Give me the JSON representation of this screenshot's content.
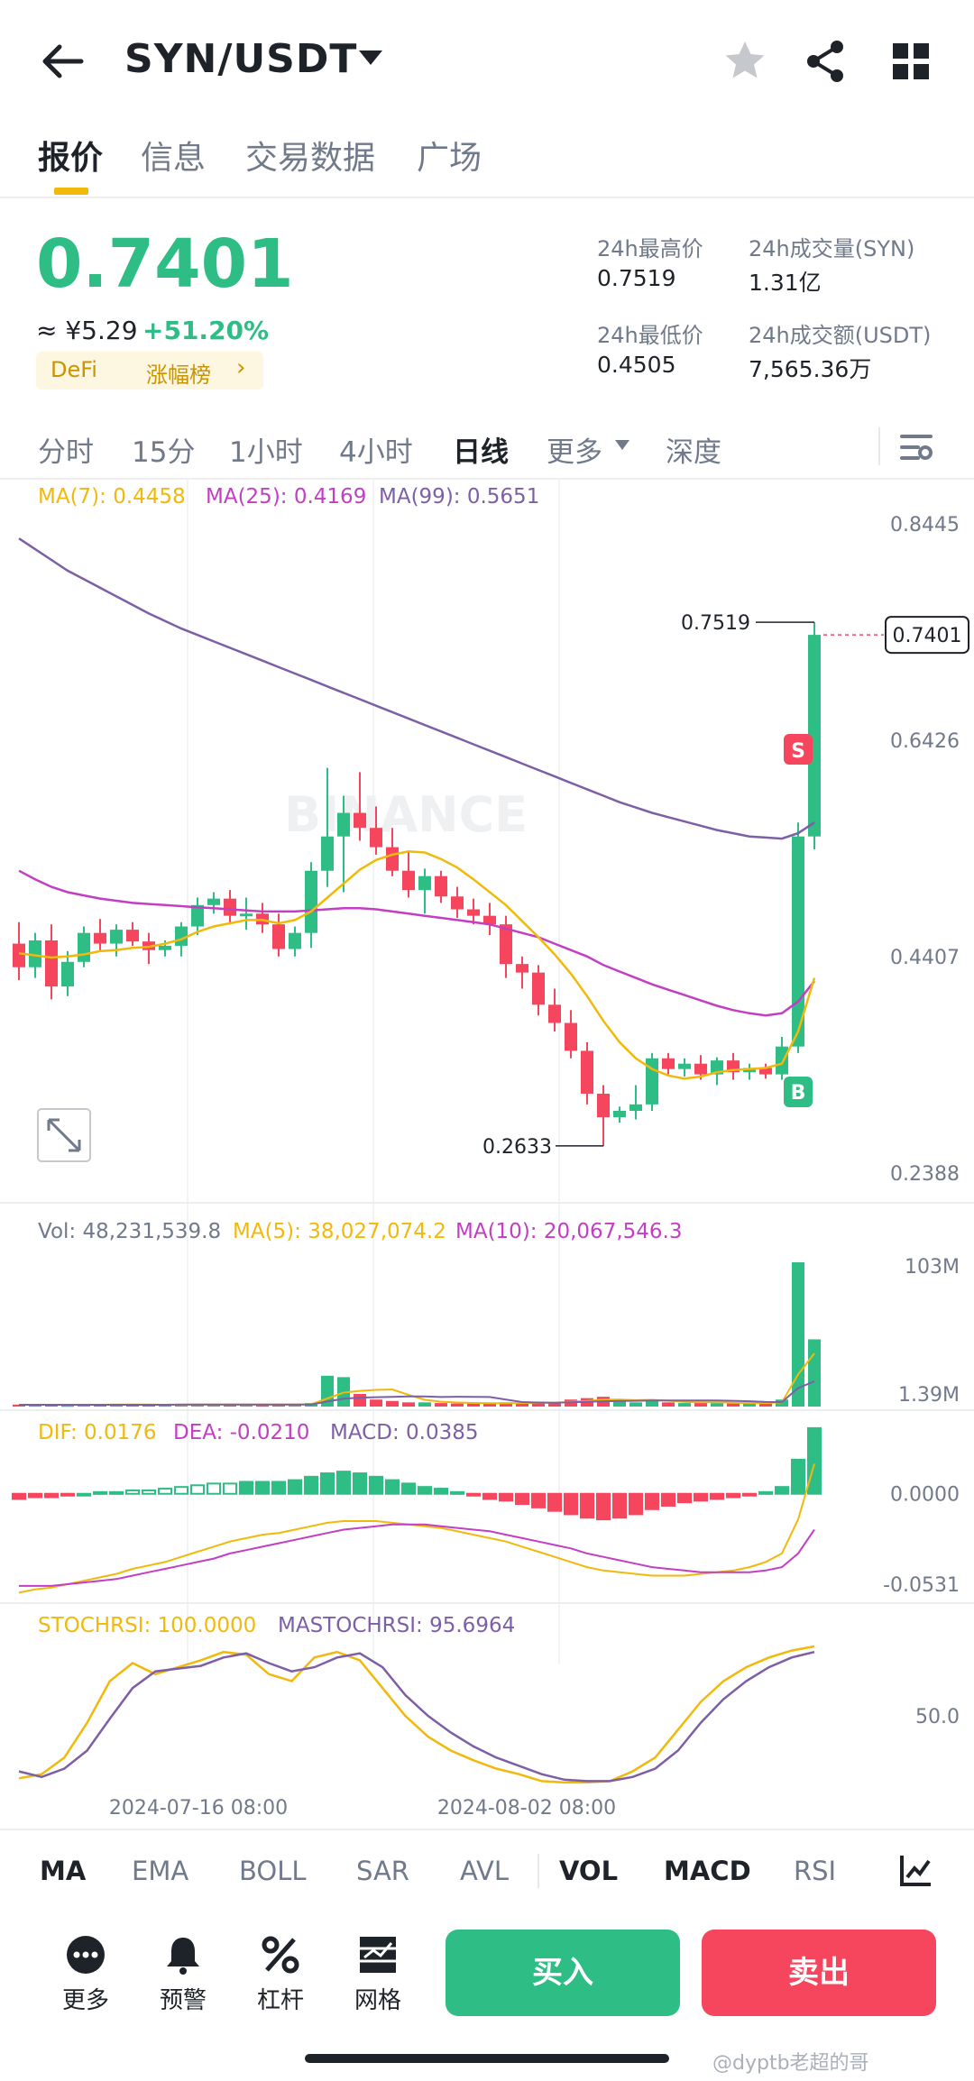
{
  "header": {
    "pair": "SYN/USDT",
    "back_icon": "arrow-left-icon",
    "favorite_icon": "star-icon",
    "share_icon": "share-icon",
    "menu_icon": "grid-icon"
  },
  "tabs": [
    {
      "label": "报价",
      "active": true
    },
    {
      "label": "信息",
      "active": false
    },
    {
      "label": "交易数据",
      "active": false
    },
    {
      "label": "广场",
      "active": false
    }
  ],
  "ticker": {
    "price": "0.7401",
    "cny": "≈ ¥5.29",
    "change": "+51.20%",
    "tag_category": "DeFi",
    "tag_rank": "涨幅榜",
    "tag_arrow": "›",
    "high_label": "24h最高价",
    "high_value": "0.7519",
    "low_label": "24h最低价",
    "low_value": "0.4505",
    "vol_label": "24h成交量(SYN)",
    "vol_value": "1.31亿",
    "amt_label": "24h成交额(USDT)",
    "amt_value": "7,565.36万"
  },
  "intervals": [
    {
      "label": "分时",
      "active": false
    },
    {
      "label": "15分",
      "active": false
    },
    {
      "label": "1小时",
      "active": false
    },
    {
      "label": "4小时",
      "active": false
    },
    {
      "label": "日线",
      "active": true
    },
    {
      "label": "更多",
      "active": false
    },
    {
      "label": "深度",
      "active": false
    }
  ],
  "chart_settings_icon": "chart-settings-icon",
  "colors": {
    "up": "#2ebd85",
    "down": "#f6465d",
    "ma7": "#f0b90b",
    "ma25": "#c23fc4",
    "ma99": "#7d5fa6",
    "accent": "#f0b90b"
  },
  "chart_data": {
    "type": "candlestick",
    "legend": {
      "ma7": "MA(7): 0.4458",
      "ma25": "MA(25): 0.4169",
      "ma99": "MA(99): 0.5651"
    },
    "price_ticks": [
      "0.8445",
      "0.6426",
      "0.4407",
      "0.2388"
    ],
    "price_range": [
      0.2388,
      0.8445
    ],
    "current_price_label": "0.7401",
    "high_marker": "0.7519",
    "low_marker": "0.2633",
    "sell_marker": "S",
    "buy_marker": "B",
    "watermark": "BINANCE",
    "candles": [
      [
        0.452,
        0.472,
        0.418,
        0.43
      ],
      [
        0.43,
        0.462,
        0.42,
        0.455
      ],
      [
        0.455,
        0.47,
        0.4,
        0.412
      ],
      [
        0.412,
        0.445,
        0.403,
        0.435
      ],
      [
        0.435,
        0.468,
        0.43,
        0.462
      ],
      [
        0.462,
        0.475,
        0.445,
        0.452
      ],
      [
        0.452,
        0.47,
        0.44,
        0.465
      ],
      [
        0.465,
        0.472,
        0.45,
        0.454
      ],
      [
        0.454,
        0.462,
        0.433,
        0.446
      ],
      [
        0.446,
        0.455,
        0.44,
        0.45
      ],
      [
        0.45,
        0.472,
        0.44,
        0.468
      ],
      [
        0.468,
        0.495,
        0.46,
        0.488
      ],
      [
        0.488,
        0.5,
        0.48,
        0.494
      ],
      [
        0.494,
        0.502,
        0.47,
        0.478
      ],
      [
        0.478,
        0.495,
        0.465,
        0.48
      ],
      [
        0.48,
        0.49,
        0.462,
        0.47
      ],
      [
        0.47,
        0.48,
        0.44,
        0.447
      ],
      [
        0.447,
        0.468,
        0.44,
        0.462
      ],
      [
        0.462,
        0.528,
        0.448,
        0.52
      ],
      [
        0.52,
        0.616,
        0.505,
        0.552
      ],
      [
        0.552,
        0.59,
        0.5,
        0.574
      ],
      [
        0.574,
        0.612,
        0.548,
        0.56
      ],
      [
        0.56,
        0.58,
        0.535,
        0.542
      ],
      [
        0.542,
        0.56,
        0.515,
        0.52
      ],
      [
        0.52,
        0.538,
        0.495,
        0.502
      ],
      [
        0.502,
        0.522,
        0.48,
        0.515
      ],
      [
        0.515,
        0.52,
        0.49,
        0.496
      ],
      [
        0.496,
        0.505,
        0.476,
        0.484
      ],
      [
        0.484,
        0.494,
        0.47,
        0.478
      ],
      [
        0.478,
        0.49,
        0.46,
        0.47
      ],
      [
        0.47,
        0.478,
        0.42,
        0.433
      ],
      [
        0.433,
        0.44,
        0.41,
        0.425
      ],
      [
        0.425,
        0.432,
        0.385,
        0.395
      ],
      [
        0.395,
        0.41,
        0.37,
        0.378
      ],
      [
        0.378,
        0.39,
        0.345,
        0.352
      ],
      [
        0.352,
        0.36,
        0.302,
        0.312
      ],
      [
        0.312,
        0.32,
        0.263,
        0.29
      ],
      [
        0.29,
        0.3,
        0.285,
        0.296
      ],
      [
        0.296,
        0.32,
        0.288,
        0.302
      ],
      [
        0.302,
        0.35,
        0.296,
        0.345
      ],
      [
        0.345,
        0.35,
        0.33,
        0.335
      ],
      [
        0.335,
        0.345,
        0.328,
        0.34
      ],
      [
        0.34,
        0.348,
        0.325,
        0.33
      ],
      [
        0.33,
        0.346,
        0.32,
        0.343
      ],
      [
        0.343,
        0.35,
        0.325,
        0.332
      ],
      [
        0.332,
        0.34,
        0.325,
        0.336
      ],
      [
        0.336,
        0.34,
        0.326,
        0.33
      ],
      [
        0.33,
        0.365,
        0.325,
        0.356
      ],
      [
        0.356,
        0.565,
        0.35,
        0.552
      ],
      [
        0.552,
        0.7519,
        0.54,
        0.7401
      ]
    ],
    "ma7": [
      0.443,
      0.441,
      0.439,
      0.44,
      0.442,
      0.445,
      0.446,
      0.448,
      0.449,
      0.452,
      0.456,
      0.463,
      0.468,
      0.471,
      0.474,
      0.474,
      0.471,
      0.474,
      0.482,
      0.495,
      0.508,
      0.521,
      0.53,
      0.535,
      0.538,
      0.537,
      0.531,
      0.523,
      0.512,
      0.5,
      0.488,
      0.473,
      0.458,
      0.442,
      0.424,
      0.403,
      0.38,
      0.36,
      0.345,
      0.335,
      0.329,
      0.326,
      0.328,
      0.332,
      0.334,
      0.335,
      0.336,
      0.34,
      0.37,
      0.42
    ],
    "ma25": [
      0.52,
      0.512,
      0.505,
      0.5,
      0.497,
      0.494,
      0.492,
      0.49,
      0.489,
      0.488,
      0.487,
      0.486,
      0.485,
      0.484,
      0.483,
      0.482,
      0.482,
      0.482,
      0.483,
      0.484,
      0.485,
      0.485,
      0.484,
      0.482,
      0.48,
      0.478,
      0.476,
      0.474,
      0.472,
      0.47,
      0.466,
      0.462,
      0.458,
      0.452,
      0.446,
      0.44,
      0.432,
      0.426,
      0.42,
      0.414,
      0.409,
      0.404,
      0.399,
      0.394,
      0.39,
      0.387,
      0.385,
      0.387,
      0.398,
      0.417
    ],
    "ma99": [
      0.83,
      0.82,
      0.81,
      0.8,
      0.792,
      0.784,
      0.776,
      0.768,
      0.76,
      0.753,
      0.746,
      0.74,
      0.734,
      0.728,
      0.722,
      0.716,
      0.71,
      0.704,
      0.698,
      0.692,
      0.686,
      0.68,
      0.674,
      0.668,
      0.662,
      0.656,
      0.65,
      0.644,
      0.638,
      0.632,
      0.626,
      0.62,
      0.614,
      0.608,
      0.602,
      0.596,
      0.59,
      0.584,
      0.579,
      0.574,
      0.57,
      0.566,
      0.562,
      0.558,
      0.555,
      0.552,
      0.551,
      0.55,
      0.555,
      0.565
    ],
    "volume": {
      "legend": {
        "vol": "Vol: 48,231,539.8",
        "ma5": "MA(5): 38,027,074.2",
        "ma10": "MA(10): 20,067,546.3"
      },
      "ticks": [
        "103M",
        "1.39M"
      ],
      "range": [
        0,
        103
      ],
      "values": [
        1.4,
        1.2,
        1.6,
        1.1,
        1.3,
        1.5,
        1.2,
        1.4,
        1.3,
        1.2,
        1.5,
        1.8,
        1.6,
        1.4,
        1.3,
        1.2,
        1.5,
        1.6,
        2.5,
        22,
        21,
        9,
        5,
        4,
        3,
        3,
        2.5,
        2.2,
        2.4,
        2.1,
        3,
        2.5,
        3.5,
        3,
        5,
        6,
        7,
        4,
        3,
        4,
        3,
        2.5,
        3,
        2.5,
        2.2,
        2.5,
        2.4,
        5,
        103,
        48
      ],
      "ma5": [
        1.3,
        1.3,
        1.3,
        1.3,
        1.3,
        1.3,
        1.4,
        1.4,
        1.4,
        1.3,
        1.3,
        1.4,
        1.4,
        1.4,
        1.5,
        1.5,
        1.4,
        1.4,
        1.6,
        5.8,
        10.0,
        11.2,
        11.9,
        12.2,
        8.4,
        4.8,
        3.5,
        2.9,
        2.6,
        2.4,
        2.4,
        2.5,
        2.7,
        2.8,
        3.4,
        4.0,
        4.9,
        5.0,
        4.6,
        4.8,
        4.2,
        3.3,
        3.1,
        3.0,
        2.8,
        2.5,
        2.5,
        3.0,
        23.0,
        38.0
      ],
      "ma10": [
        1.3,
        1.3,
        1.3,
        1.3,
        1.3,
        1.3,
        1.3,
        1.3,
        1.3,
        1.3,
        1.4,
        1.4,
        1.4,
        1.4,
        1.4,
        1.4,
        1.4,
        1.4,
        1.5,
        3.6,
        5.6,
        6.4,
        6.7,
        6.9,
        7.2,
        7.3,
        6.8,
        7.0,
        6.9,
        6.8,
        5.0,
        3.2,
        2.9,
        2.8,
        3.1,
        3.4,
        3.8,
        4.0,
        4.1,
        4.3,
        4.4,
        4.4,
        4.4,
        4.4,
        4.1,
        3.8,
        3.3,
        3.2,
        13.2,
        18.0
      ]
    },
    "macd": {
      "legend": {
        "dif": "DIF: 0.0176",
        "dea": "DEA: -0.0210",
        "macd": "MACD: 0.0385"
      },
      "ticks": [
        "0.0000",
        "-0.0531"
      ],
      "range": [
        -0.062,
        0.03
      ],
      "hist": [
        -0.003,
        -0.002,
        -0.002,
        -0.001,
        0.0,
        0.001,
        0.001,
        0.002,
        0.002,
        0.003,
        0.004,
        0.005,
        0.006,
        0.006,
        0.007,
        0.007,
        0.007,
        0.008,
        0.01,
        0.012,
        0.013,
        0.012,
        0.01,
        0.008,
        0.006,
        0.004,
        0.003,
        0.001,
        -0.001,
        -0.003,
        -0.004,
        -0.006,
        -0.008,
        -0.01,
        -0.012,
        -0.014,
        -0.015,
        -0.014,
        -0.012,
        -0.009,
        -0.007,
        -0.005,
        -0.004,
        -0.003,
        -0.002,
        -0.001,
        0.001,
        0.004,
        0.02,
        0.0385
      ],
      "dif": [
        -0.058,
        -0.056,
        -0.055,
        -0.053,
        -0.051,
        -0.049,
        -0.047,
        -0.044,
        -0.042,
        -0.04,
        -0.037,
        -0.034,
        -0.031,
        -0.028,
        -0.026,
        -0.024,
        -0.023,
        -0.021,
        -0.019,
        -0.017,
        -0.016,
        -0.016,
        -0.016,
        -0.017,
        -0.018,
        -0.019,
        -0.02,
        -0.022,
        -0.024,
        -0.026,
        -0.028,
        -0.031,
        -0.034,
        -0.037,
        -0.04,
        -0.043,
        -0.045,
        -0.046,
        -0.047,
        -0.048,
        -0.048,
        -0.048,
        -0.047,
        -0.046,
        -0.045,
        -0.043,
        -0.04,
        -0.035,
        -0.015,
        0.0176
      ],
      "dea": [
        -0.054,
        -0.054,
        -0.054,
        -0.053,
        -0.052,
        -0.051,
        -0.05,
        -0.048,
        -0.046,
        -0.044,
        -0.042,
        -0.04,
        -0.038,
        -0.035,
        -0.033,
        -0.031,
        -0.029,
        -0.027,
        -0.025,
        -0.023,
        -0.021,
        -0.02,
        -0.019,
        -0.018,
        -0.018,
        -0.018,
        -0.019,
        -0.02,
        -0.021,
        -0.022,
        -0.024,
        -0.026,
        -0.028,
        -0.03,
        -0.032,
        -0.035,
        -0.037,
        -0.039,
        -0.041,
        -0.043,
        -0.044,
        -0.045,
        -0.046,
        -0.046,
        -0.046,
        -0.046,
        -0.045,
        -0.043,
        -0.035,
        -0.021
      ]
    },
    "stochrsi": {
      "legend": {
        "stoch": "STOCHRSI: 100.0000",
        "ma": "MASTOCHRSI: 95.6964"
      },
      "ticks": [
        "50.0"
      ],
      "range": [
        0,
        100
      ],
      "stoch": [
        5,
        8,
        20,
        45,
        75,
        88,
        80,
        85,
        90,
        96,
        94,
        80,
        75,
        92,
        96,
        90,
        70,
        50,
        35,
        25,
        18,
        12,
        8,
        3,
        2,
        2,
        3,
        10,
        20,
        40,
        60,
        75,
        85,
        92,
        97,
        100
      ],
      "ma": [
        10,
        6,
        12,
        25,
        48,
        70,
        82,
        84,
        86,
        92,
        95,
        88,
        82,
        85,
        92,
        95,
        85,
        65,
        50,
        38,
        28,
        20,
        14,
        8,
        4,
        3,
        3,
        6,
        12,
        25,
        45,
        62,
        75,
        85,
        92,
        96
      ],
      "dates": [
        "2024-07-16 08:00",
        "2024-08-02 08:00"
      ]
    }
  },
  "expand_icon": "expand-icon",
  "indicators": [
    {
      "label": "MA",
      "on": true
    },
    {
      "label": "EMA",
      "on": false
    },
    {
      "label": "BOLL",
      "on": false
    },
    {
      "label": "SAR",
      "on": false
    },
    {
      "label": "AVL",
      "on": false
    },
    {
      "label": "VOL",
      "on": true
    },
    {
      "label": "MACD",
      "on": true
    },
    {
      "label": "RSI",
      "on": false
    }
  ],
  "indicator_settings_icon": "line-chart-icon",
  "actions": [
    {
      "label": "更多",
      "icon": "more-icon"
    },
    {
      "label": "预警",
      "icon": "bell-icon"
    },
    {
      "label": "杠杆",
      "icon": "percent-icon"
    },
    {
      "label": "网格",
      "icon": "grid-trading-icon"
    }
  ],
  "buy_label": "买入",
  "sell_label": "卖出",
  "watermark_text": "@dyptb老超的哥"
}
